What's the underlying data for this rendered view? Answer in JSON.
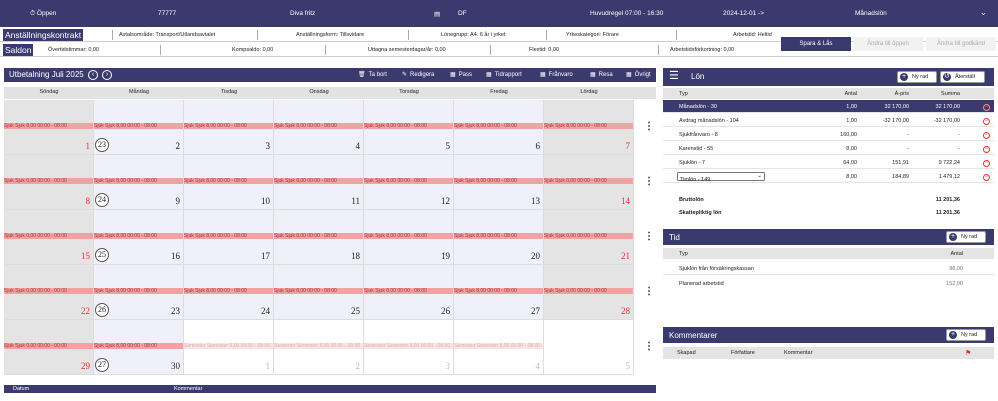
{
  "topbar": {
    "status": "Öppen",
    "number": "77777",
    "name": "Diva fritz",
    "dept": "DF",
    "schedule": "Huvudregel 07:00 - 16:30",
    "date": "2024-12-01 ->",
    "period": "Månadslön"
  },
  "contract": {
    "label": "Anställningskontrakt",
    "area": "Avtalsområde: Transport/Utlandsavtalet",
    "form": "Anställningsform: Tillsvidare",
    "wage_group": "Lönegrupp: A4. 6 år i yrket",
    "category": "Yrkeskategori: Förare",
    "worktime": "Arbetstid: Heltid"
  },
  "balance": {
    "label": "Saldon",
    "overtime": "Övertidstimmar: 0,00",
    "comp": "Kompsaldo: 0,00",
    "vacation": "Uttagna semesterdagar/år: 0,00",
    "flex": "Flextid: 0,00",
    "reduction": "Arbetstidsförkortning: 0,00"
  },
  "actions": {
    "save_lock": "Spara & Lås",
    "change_open": "Ändra till öppen",
    "change_approved": "Ändra till godkänd"
  },
  "calendar": {
    "title": "Utbetalning Juli 2025",
    "prev": "‹",
    "next": "›",
    "toolbar": {
      "delete": "Ta bort",
      "edit": "Redigera",
      "pass": "Pass",
      "report": "Tidrapport",
      "absence": "Frånvaro",
      "trip": "Resa",
      "other": "Övrigt"
    },
    "days": [
      "Söndag",
      "Måndag",
      "Tisdag",
      "Onsdag",
      "Torsdag",
      "Fredag",
      "Lördag"
    ],
    "kebab": "⋮",
    "weeks": [
      {
        "wk": "",
        "cells": [
          {
            "d": "1",
            "bar": "Sjuk Sjuk 8,00 00:00 - 08:00"
          },
          {
            "d": "2",
            "bar": "Sjuk Sjuk 8,00 00:00 - 08:00"
          },
          {
            "d": "3",
            "bar": "Sjuk Sjuk 8,00 00:00 - 08:00"
          },
          {
            "d": "4",
            "bar": "Sjuk Sjuk 8,00 00:00 - 08:00"
          },
          {
            "d": "5",
            "bar": "Sjuk Sjuk 8,00 00:00 - 08:00"
          },
          {
            "d": "6",
            "bar": "Sjuk Sjuk 8,00 00:00 - 08:00"
          },
          {
            "d": "7",
            "bar": "Sjuk Sjuk 8,00 00:00 - 08:00"
          }
        ]
      },
      {
        "wk": "23",
        "cells": [
          {
            "d": "8",
            "bar": "Sjuk Sjuk 0,00 00:00 - 00:00"
          },
          {
            "d": "9",
            "bar": "Sjuk Sjuk 8,00 00:00 - 08:00"
          },
          {
            "d": "10",
            "bar": "Sjuk Sjuk 8,00 00:00 - 08:00"
          },
          {
            "d": "11",
            "bar": "Sjuk Sjuk 8,00 00:00 - 08:00"
          },
          {
            "d": "12",
            "bar": "Sjuk Sjuk 8,00 00:00 - 08:00"
          },
          {
            "d": "13",
            "bar": "Sjuk Sjuk 8,00 00:00 - 08:00"
          },
          {
            "d": "14",
            "bar": "Sjuk Sjuk 0,00 00:00 - 00:00"
          }
        ]
      },
      {
        "wk": "24",
        "cells": [
          {
            "d": "15",
            "bar": "Sjuk Sjuk 0,00 00:00 - 00:00"
          },
          {
            "d": "16",
            "bar": "Sjuk Sjuk 8,00 00:00 - 08:00"
          },
          {
            "d": "17",
            "bar": "Sjuk Sjuk 8,00 00:00 - 08:00"
          },
          {
            "d": "18",
            "bar": "Sjuk Sjuk 8,00 00:00 - 08:00"
          },
          {
            "d": "19",
            "bar": "Sjuk Sjuk 8,00 00:00 - 08:00"
          },
          {
            "d": "20",
            "bar": "Sjuk Sjuk 8,00 00:00 - 08:00"
          },
          {
            "d": "21",
            "bar": "Sjuk Sjuk 0,00 00:00 - 00:00"
          }
        ]
      },
      {
        "wk": "25",
        "cells": [
          {
            "d": "22",
            "bar": "Sjuk Sjuk 0,00 00:00 - 00:00"
          },
          {
            "d": "23",
            "bar": "Sjuk Sjuk 8,00 00:00 - 08:00"
          },
          {
            "d": "24",
            "bar": "Sjuk Sjuk 8,00 00:00 - 08:00"
          },
          {
            "d": "25",
            "bar": "Sjuk Sjuk 8,00 00:00 - 08:00"
          },
          {
            "d": "26",
            "bar": "Sjuk Sjuk 8,00 00:00 - 08:00"
          },
          {
            "d": "27",
            "bar": "Sjuk Sjuk 8,00 00:00 - 08:00"
          },
          {
            "d": "28",
            "bar": "Sjuk Sjuk 0,00 00:00 - 00:00"
          }
        ]
      },
      {
        "wk": "26",
        "cells": [
          {
            "d": "29",
            "bar": "Sjuk Sjuk 0,00 00:00 - 00:00"
          },
          {
            "d": "30",
            "bar": "Sjuk Sjuk 8,00 00:00 - 08:00"
          },
          {
            "d": "1",
            "bar": "Semester Semester 8,00 00:00 - 08:00"
          },
          {
            "d": "2",
            "bar": "Semester Semester 8,00 00:00 - 08:00"
          },
          {
            "d": "3",
            "bar": "Semester Semester 8,00 00:00 - 08:00"
          },
          {
            "d": "4",
            "bar": "Semester Semester 8,00 00:00 - 08:00"
          },
          {
            "d": "5",
            "bar": ""
          }
        ]
      }
    ],
    "extra_week": "27",
    "footer": {
      "date": "Datum",
      "comment": "Kommentar"
    }
  },
  "lon": {
    "title": "Lön",
    "new_row": "Ny rad",
    "restore": "Återställ",
    "cols": {
      "type": "Typ",
      "qty": "Antal",
      "price": "Á-pris",
      "sum": "Summa"
    },
    "rows": [
      {
        "type": "Månadslön - 30",
        "qty": "1,00",
        "price": "32 170,00",
        "sum": "32 170,00"
      },
      {
        "type": "Avdrag månadslön - 104",
        "qty": "1,00",
        "price": "-32 170,00",
        "sum": "-32 170,00"
      },
      {
        "type": "Sjukfrånvaro - 8",
        "qty": "160,00",
        "price": "-",
        "sum": "-"
      },
      {
        "type": "Karenstid - 55",
        "qty": "8,00",
        "price": "-",
        "sum": "-"
      },
      {
        "type": "Sjuklön - 7",
        "qty": "64,00",
        "price": "151,91",
        "sum": "9 722,24"
      },
      {
        "type": "Timlön - 149",
        "qty": "8,00",
        "price": "184,89",
        "sum": "1 479,12"
      }
    ],
    "gross_label": "Bruttolön",
    "gross": "11 201,36",
    "taxable_label": "Skattepliktig lön",
    "taxable": "11 201,36"
  },
  "tid": {
    "title": "Tid",
    "new_row": "Ny rad",
    "cols": {
      "type": "Typ",
      "qty": "Antal"
    },
    "rows": [
      {
        "type": "Sjuklön från försäkringskassan",
        "qty": "88,00"
      },
      {
        "type": "Planerad arbetstid",
        "qty": "152,00"
      }
    ]
  },
  "comments": {
    "title": "Kommentarer",
    "new_row": "Ny rad",
    "cols": {
      "created": "Skapad",
      "author": "Författare",
      "comment": "Kommentar"
    }
  },
  "colors": {
    "primary": "#3a3a6e",
    "sick": "#f1a3a3",
    "weekend": "#e4e4e4",
    "red": "#d33"
  }
}
